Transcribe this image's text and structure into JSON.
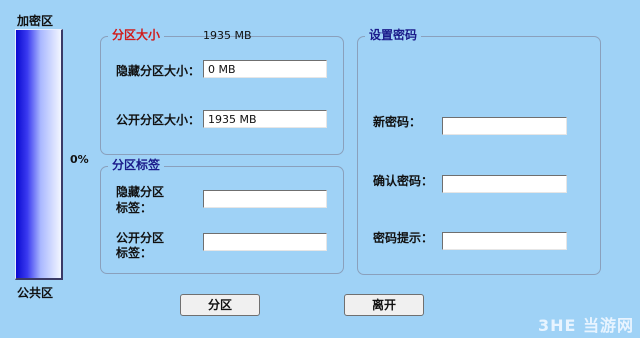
{
  "gauge": {
    "top_label": "加密区",
    "bottom_label": "公共区",
    "percent": "0%",
    "fill_fraction": 0
  },
  "partition_size": {
    "title": "分区大小",
    "total": "1935 MB",
    "hidden_label": "隐藏分区大小：",
    "hidden_value": "0 MB",
    "public_label": "公开分区大小：",
    "public_value": "1935 MB"
  },
  "partition_label": {
    "title": "分区标签",
    "hidden_label_line1": "隐藏分区",
    "hidden_label_line2": "标签：",
    "hidden_value": "",
    "public_label_line1": "公开分区",
    "public_label_line2": "标签：",
    "public_value": ""
  },
  "password": {
    "title": "设置密码",
    "new_label": "新密码：",
    "new_value": "",
    "confirm_label": "确认密码：",
    "confirm_value": "",
    "hint_label": "密码提示：",
    "hint_value": ""
  },
  "buttons": {
    "partition": "分区",
    "exit": "离开"
  },
  "watermark": "3HE 当游网",
  "colors": {
    "background": "#9fd2f6",
    "title_red": "#d01a1a",
    "title_blue": "#1a1a8a",
    "gauge_blue": "#0a0ad0"
  }
}
